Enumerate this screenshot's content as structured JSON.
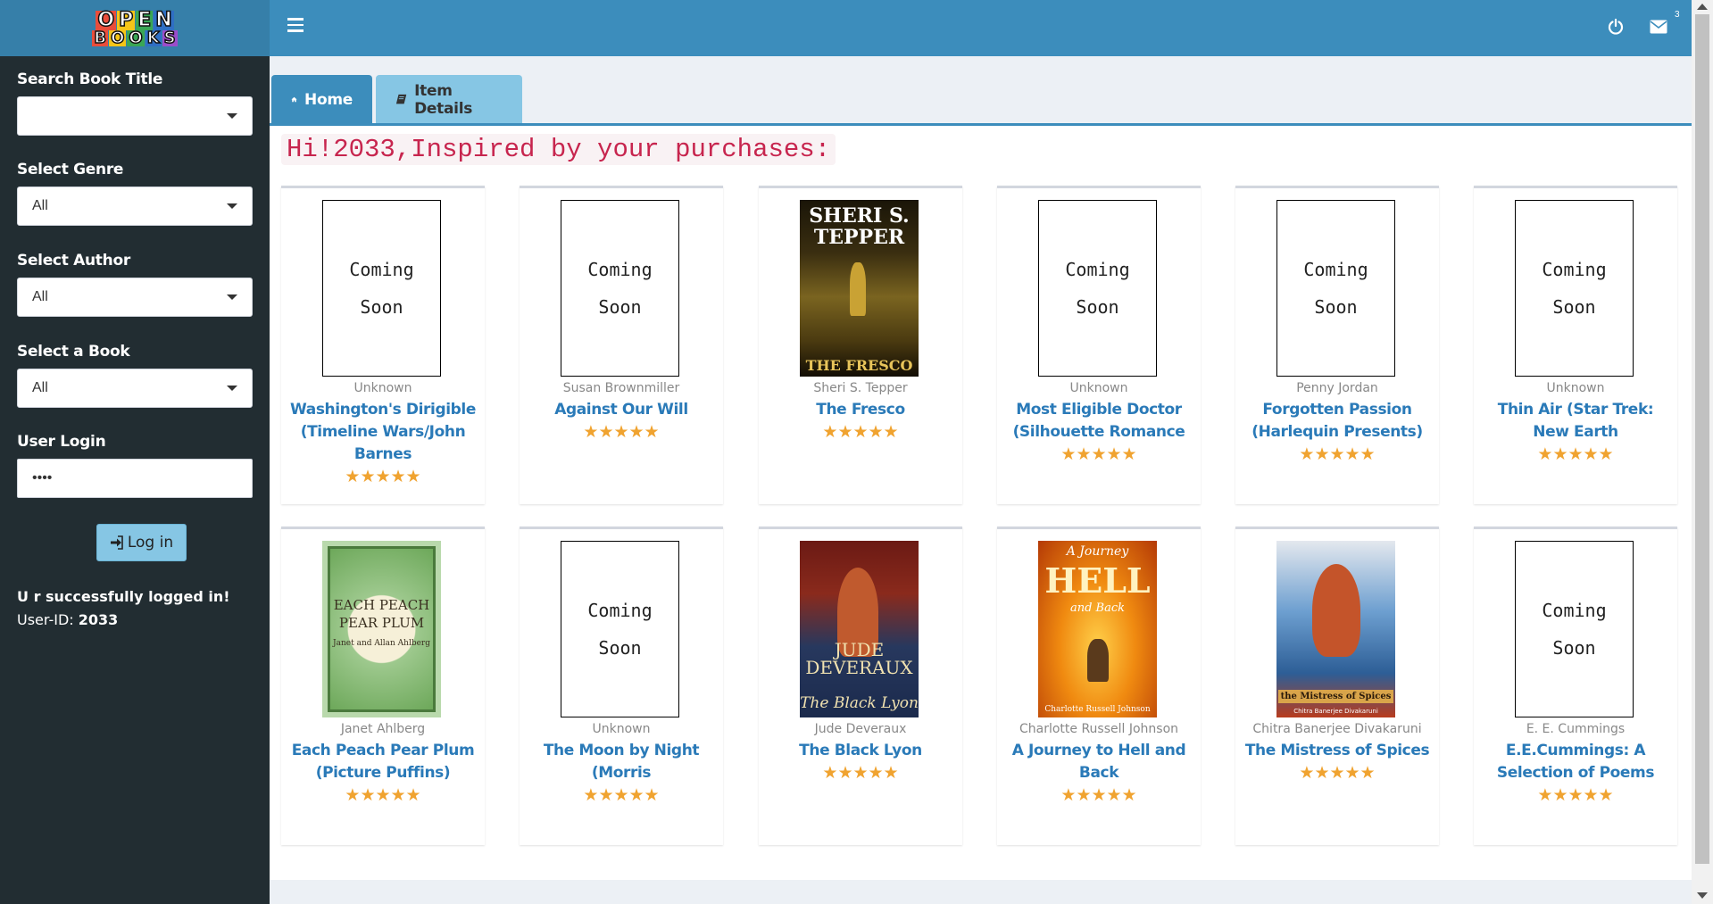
{
  "brand": {
    "logo_line1": [
      "O",
      "P",
      "E",
      "N",
      ""
    ],
    "logo_line2": [
      "B",
      "O",
      "O",
      "K",
      "S"
    ]
  },
  "sidebar": {
    "search_label": "Search Book Title",
    "search_value": "",
    "genre_label": "Select Genre",
    "genre_value": "All",
    "author_label": "Select Author",
    "author_value": "All",
    "book_label": "Select a Book",
    "book_value": "All",
    "login_label": "User Login",
    "login_value": "••••",
    "login_button": "Log in",
    "login_message": "U r successfully logged in!",
    "userid_prefix": "User-ID: ",
    "userid_value": "2033"
  },
  "header": {
    "mail_count": "3",
    "icons": [
      "hamburger-icon",
      "power-icon",
      "envelope-icon"
    ]
  },
  "tabs": [
    {
      "label": "Home",
      "icon": "home-icon"
    },
    {
      "label": "Item Details",
      "icon": "book-icon"
    }
  ],
  "greeting": "Hi!2033,Inspired by your purchases:",
  "coming_soon": {
    "line1": "Coming",
    "line2": "Soon"
  },
  "books": [
    {
      "author": "Unknown",
      "title": "Washington's Dirigible (Timeline Wars/John Barnes",
      "rating": "★★★★★",
      "cover": "coming-soon"
    },
    {
      "author": "Susan Brownmiller",
      "title": "Against Our Will",
      "rating": "★★★★★",
      "cover": "coming-soon"
    },
    {
      "author": "Sheri S. Tepper",
      "title": "The Fresco",
      "rating": "★★★★★",
      "cover": "fresco",
      "cover_text": [
        "SHERI S.",
        "TEPPER",
        "THE FRESCO"
      ]
    },
    {
      "author": "Unknown",
      "title": "Most Eligible Doctor (Silhouette Romance",
      "rating": "★★★★★",
      "cover": "coming-soon"
    },
    {
      "author": "Penny Jordan",
      "title": "Forgotten Passion (Harlequin Presents)",
      "rating": "★★★★★",
      "cover": "coming-soon"
    },
    {
      "author": "Unknown",
      "title": "Thin Air (Star Trek: New Earth",
      "rating": "★★★★★",
      "cover": "coming-soon"
    },
    {
      "author": "Janet Ahlberg",
      "title": "Each Peach Pear Plum (Picture Puffins)",
      "rating": "★★★★★",
      "cover": "peach",
      "cover_text": [
        "EACH PEACH",
        "PEAR PLUM",
        "Janet and Allan Ahlberg"
      ]
    },
    {
      "author": "Unknown",
      "title": "The Moon by Night (Morris",
      "rating": "★★★★★",
      "cover": "coming-soon"
    },
    {
      "author": "Jude Deveraux",
      "title": "The Black Lyon",
      "rating": "★★★★★",
      "cover": "lyon",
      "cover_text": [
        "JUDE",
        "DEVERAUX",
        "The Black Lyon"
      ]
    },
    {
      "author": "Charlotte Russell Johnson",
      "title": "A Journey to Hell and Back",
      "rating": "★★★★★",
      "cover": "hell",
      "cover_text": [
        "A Journey",
        "HELL",
        "and Back",
        "Charlotte Russell Johnson"
      ]
    },
    {
      "author": "Chitra Banerjee Divakaruni",
      "title": "The Mistress of Spices",
      "rating": "★★★★★",
      "cover": "spices",
      "cover_text": [
        "the Mistress of Spices",
        "Chitra Banerjee Divakaruni"
      ]
    },
    {
      "author": "E. E. Cummings",
      "title": "E.E.Cummings: A Selection of Poems",
      "rating": "★★★★★",
      "cover": "coming-soon"
    }
  ],
  "colors": {
    "header": "#3c8dbc",
    "sidebar": "#222d32",
    "title_link": "#2a7ab8",
    "star": "#f0a330",
    "greeting_text": "#c7254e"
  }
}
